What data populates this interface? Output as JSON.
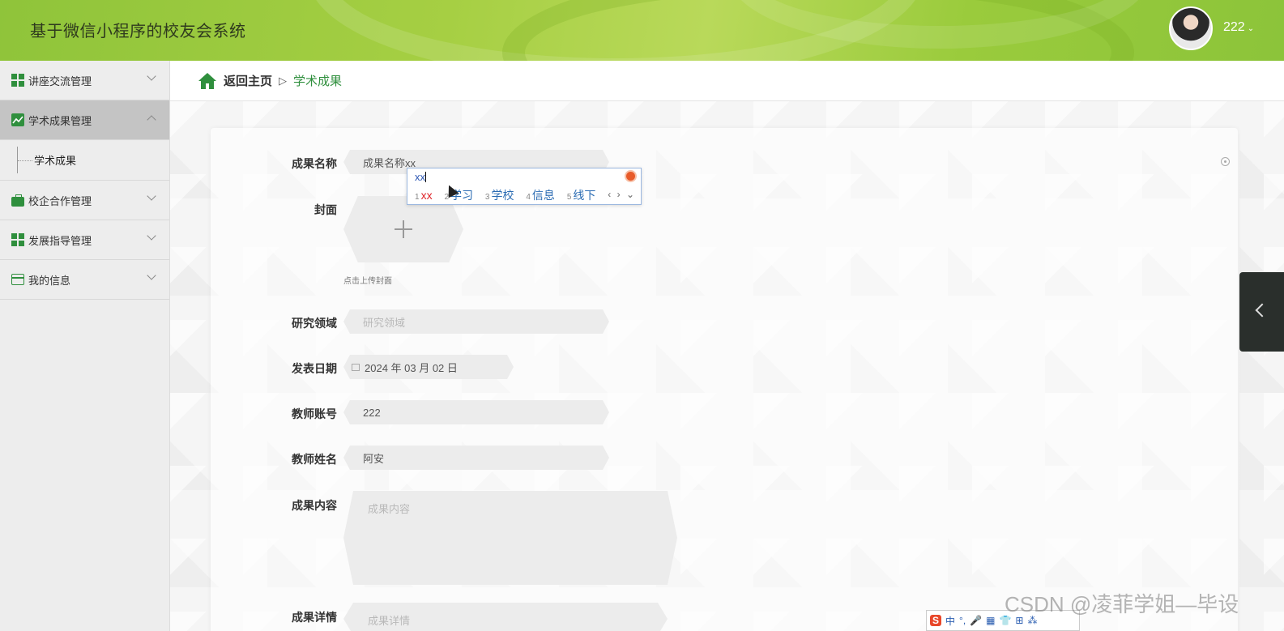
{
  "header": {
    "app_title": "基于微信小程序的校友会系统",
    "username": "222",
    "caret": "⌄"
  },
  "sidebar": {
    "items": [
      {
        "label": "讲座交流管理",
        "icon": "grid-icon",
        "expanded": false
      },
      {
        "label": "学术成果管理",
        "icon": "chart-icon",
        "expanded": true,
        "children": [
          {
            "label": "学术成果"
          }
        ]
      },
      {
        "label": "校企合作管理",
        "icon": "briefcase-icon",
        "expanded": false
      },
      {
        "label": "发展指导管理",
        "icon": "grid-icon",
        "expanded": false
      },
      {
        "label": "我的信息",
        "icon": "card-icon",
        "expanded": false
      }
    ]
  },
  "breadcrumb": {
    "home": "返回主页",
    "separator": "▷",
    "current": "学术成果"
  },
  "form": {
    "title_label": "成果名称",
    "title_value": "成果名称xx",
    "cover_label": "封面",
    "cover_hint": "点击上传封面",
    "field_label": "研究领域",
    "field_placeholder": "研究领域",
    "date_label": "发表日期",
    "date_value": "2024 年 03 月 02 日",
    "account_label": "教师账号",
    "account_value": "222",
    "name_label": "教师姓名",
    "name_value": "阿安",
    "content_label": "成果内容",
    "content_placeholder": "成果内容",
    "detail_label": "成果详情",
    "detail_placeholder": "成果详情"
  },
  "ime": {
    "composition": "xx",
    "candidates": [
      {
        "n": "1",
        "text": "xx"
      },
      {
        "n": "2",
        "text": "学习"
      },
      {
        "n": "3",
        "text": "学校"
      },
      {
        "n": "4",
        "text": "信息"
      },
      {
        "n": "5",
        "text": "线下"
      }
    ],
    "nav": "‹ › ⌄",
    "toolbar": [
      "中",
      "°,",
      "🎤",
      "▦",
      "👕",
      "⊞",
      "⁂"
    ]
  },
  "watermark": "CSDN @凌菲学姐—毕设",
  "colors": {
    "accent_green": "#2f8f3d",
    "header_green": "#a6cf43",
    "sidebar_active": "#c4c4c4"
  }
}
